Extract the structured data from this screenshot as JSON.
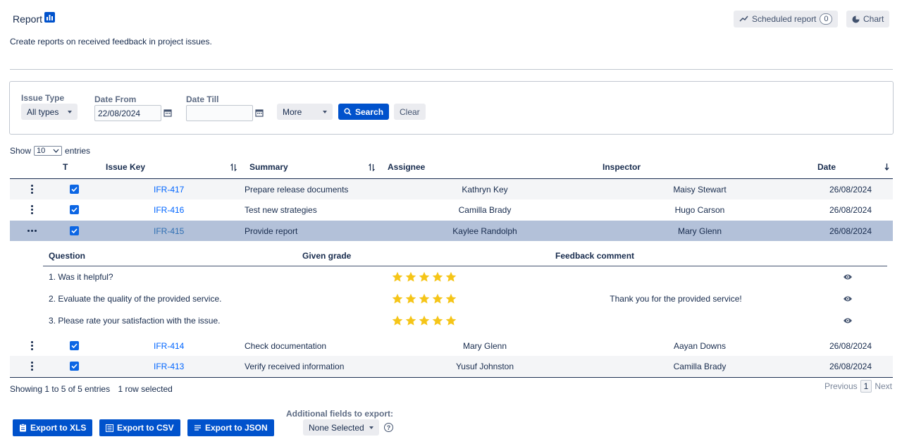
{
  "header": {
    "title": "Report",
    "subtitle": "Create reports on received feedback in project issues.",
    "scheduled_report_label": "Scheduled report",
    "scheduled_count": "0",
    "chart_label": "Chart"
  },
  "filters": {
    "issue_type_label": "Issue Type",
    "issue_type_value": "All types",
    "date_from_label": "Date From",
    "date_from_value": "22/08/2024",
    "date_till_label": "Date Till",
    "date_till_value": "",
    "more_label": "More",
    "search_label": "Search",
    "clear_label": "Clear"
  },
  "entries": {
    "show_label": "Show",
    "value": "10",
    "suffix": "entries"
  },
  "table": {
    "columns": {
      "t": "T",
      "issue_key": "Issue Key",
      "summary": "Summary",
      "assignee": "Assignee",
      "inspector": "Inspector",
      "date": "Date"
    },
    "rows": [
      {
        "key": "IFR-417",
        "summary": "Prepare release documents",
        "assignee": "Kathryn Key",
        "inspector": "Maisy Stewart",
        "date": "26/08/2024"
      },
      {
        "key": "IFR-416",
        "summary": "Test new strategies",
        "assignee": "Camilla Brady",
        "inspector": "Hugo Carson",
        "date": "26/08/2024"
      },
      {
        "key": "IFR-415",
        "summary": "Provide report",
        "assignee": "Kaylee Randolph",
        "inspector": "Mary Glenn",
        "date": "26/08/2024"
      },
      {
        "key": "IFR-414",
        "summary": "Check documentation",
        "assignee": "Mary Glenn",
        "inspector": "Aayan Downs",
        "date": "26/08/2024"
      },
      {
        "key": "IFR-413",
        "summary": "Verify received information",
        "assignee": "Yusuf Johnston",
        "inspector": "Camilla Brady",
        "date": "26/08/2024"
      }
    ]
  },
  "detail": {
    "columns": {
      "question": "Question",
      "grade": "Given grade",
      "comment": "Feedback comment"
    },
    "rows": [
      {
        "question": "1. Was it helpful?",
        "grade": 5,
        "comment": ""
      },
      {
        "question": "2. Evaluate the quality of the provided service.",
        "grade": 5,
        "comment": "Thank you for the provided service!"
      },
      {
        "question": "3. Please rate your satisfaction with the issue.",
        "grade": 5,
        "comment": ""
      }
    ]
  },
  "footer": {
    "showing": "Showing 1 to 5 of 5 entries",
    "selected": "1 row selected",
    "previous": "Previous",
    "page": "1",
    "next": "Next",
    "export_xls": "Export to XLS",
    "export_csv": "Export to CSV",
    "export_json": "Export to JSON",
    "additional_label": "Additional fields to export:",
    "additional_value": "None Selected"
  },
  "colors": {
    "primary": "#0052cc",
    "selected_row": "#b3c1d9",
    "star": "#f5c518",
    "link": "#0065ff"
  }
}
